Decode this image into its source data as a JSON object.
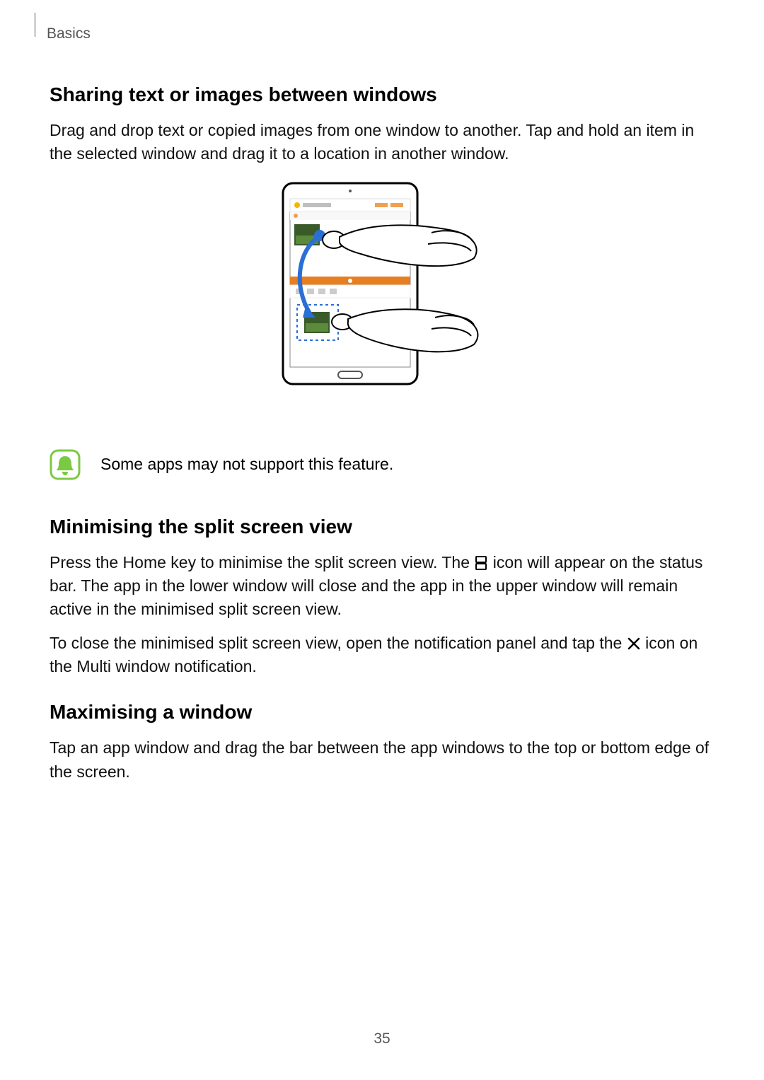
{
  "breadcrumb": "Basics",
  "page_number": "35",
  "section1": {
    "heading": "Sharing text or images between windows",
    "para": "Drag and drop text or copied images from one window to another. Tap and hold an item in the selected window and drag it to a location in another window."
  },
  "note": {
    "text": "Some apps may not support this feature."
  },
  "section2": {
    "heading": "Minimising the split screen view",
    "para1a": "Press the Home key to minimise the split screen view. The ",
    "para1b": " icon will appear on the status bar. The app in the lower window will close and the app in the upper window will remain active in the minimised split screen view.",
    "para2a": "To close the minimised split screen view, open the notification panel and tap the ",
    "para2b": " icon on the Multi window notification."
  },
  "section3": {
    "heading": "Maximising a window",
    "para": "Tap an app window and drag the bar between the app windows to the top or bottom edge of the screen."
  }
}
